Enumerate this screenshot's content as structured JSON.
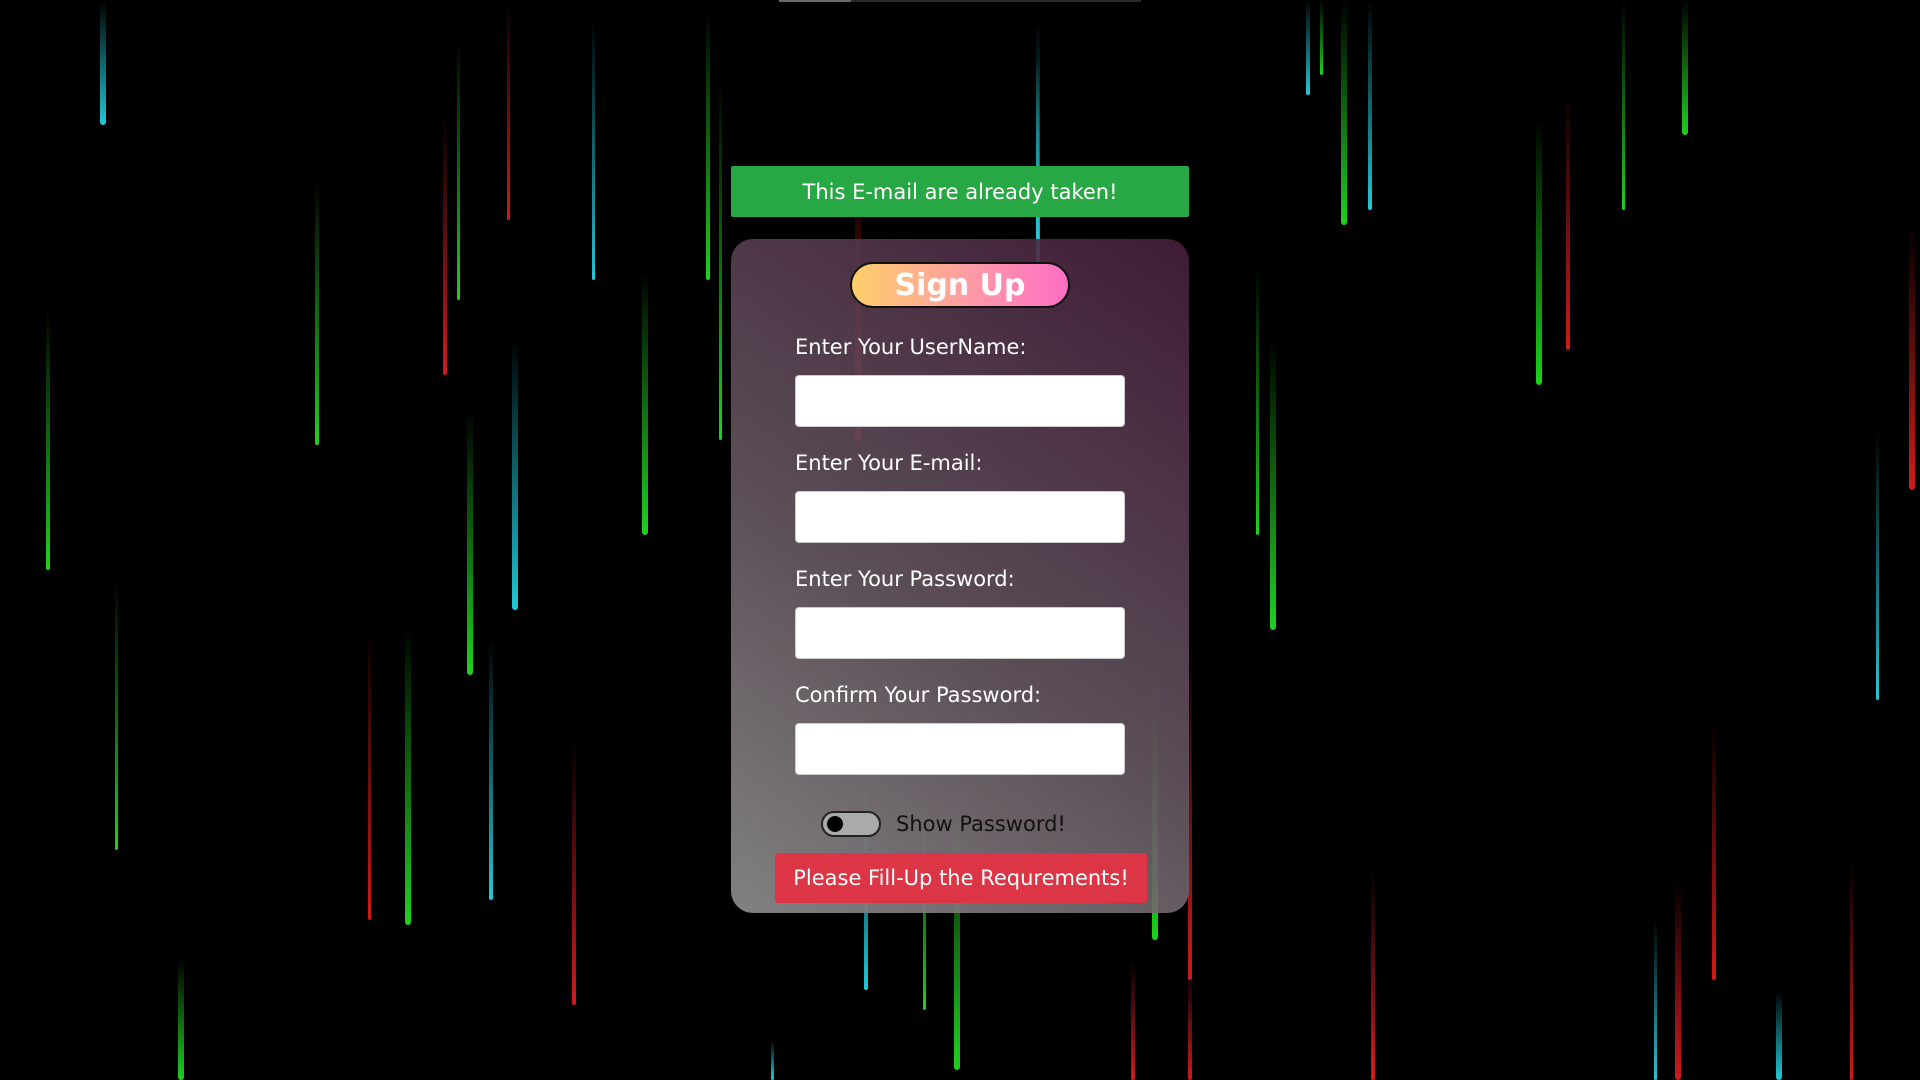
{
  "colors": {
    "page_bg": "#000000",
    "alert_success": "#28a745",
    "alert_danger": "#dc3545",
    "title_gradient_start": "#fdcf6a",
    "title_gradient_end": "#ff6ec4",
    "streak_green": "#1ed21e",
    "streak_red": "#d21a1a",
    "streak_cyan": "#22c8d6"
  },
  "alert": {
    "message": "This E-mail are already taken!"
  },
  "form": {
    "title": "Sign Up",
    "fields": [
      {
        "label": "Enter Your UserName:",
        "value": "",
        "placeholder": ""
      },
      {
        "label": "Enter Your E-mail:",
        "value": "",
        "placeholder": ""
      },
      {
        "label": "Enter Your Password:",
        "value": "",
        "placeholder": ""
      },
      {
        "label": "Confirm Your Password:",
        "value": "",
        "placeholder": ""
      }
    ],
    "show_password": {
      "label": "Show Password!",
      "checked": false
    },
    "submit_label": "Please Fill-Up the Requrements!"
  },
  "background": {
    "icon": "falling-light-streaks"
  }
}
